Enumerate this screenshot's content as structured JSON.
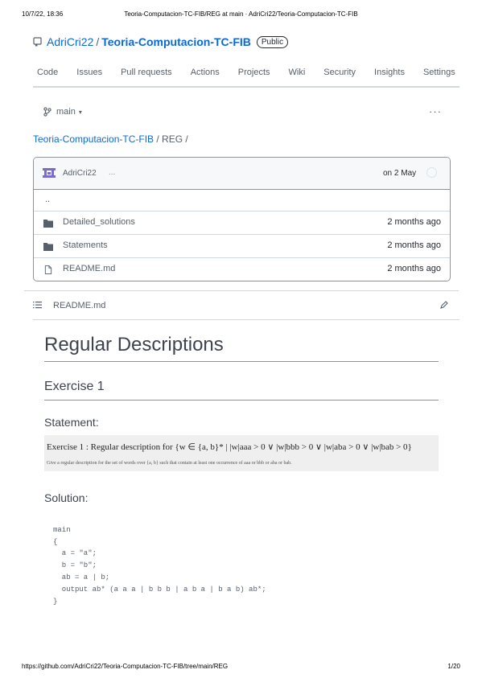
{
  "print": {
    "datetime": "10/7/22, 18:36",
    "page_title": "Teoria-Computacion-TC-FIB/REG at main · AdriCri22/Teoria-Computacion-TC-FIB",
    "url": "https://github.com/AdriCri22/Teoria-Computacion-TC-FIB/tree/main/REG",
    "page_number": "1/20"
  },
  "repo": {
    "owner": "AdriCri22",
    "separator": "/",
    "name": "Teoria-Computacion-TC-FIB",
    "visibility": "Public"
  },
  "tabs": [
    "Code",
    "Issues",
    "Pull requests",
    "Actions",
    "Projects",
    "Wiki",
    "Security",
    "Insights",
    "Settings"
  ],
  "branch": {
    "name": "main"
  },
  "breadcrumb": {
    "root": "Teoria-Computacion-TC-FIB",
    "rest": " / REG /"
  },
  "commit": {
    "author": "AdriCri22",
    "message": "...",
    "date": "on 2 May"
  },
  "files": {
    "parent": "..",
    "rows": [
      {
        "icon": "folder-icon",
        "name": "Detailed_solutions",
        "date": "2 months ago"
      },
      {
        "icon": "folder-icon",
        "name": "Statements",
        "date": "2 months ago"
      },
      {
        "icon": "file-icon",
        "name": "README.md",
        "date": "2 months ago"
      }
    ]
  },
  "readme": {
    "filename": "README.md",
    "h1": "Regular Descriptions",
    "h2": "Exercise 1",
    "statement_heading": "Statement:",
    "statement_line1": "Exercise 1 : Regular description for {w ∈ {a, b}* | |w|aaa > 0 ∨ |w|bbb > 0 ∨ |w|aba > 0 ∨ |w|bab > 0}",
    "statement_line2": "Give a regular description for the set of words over {a, b} such that contain at least one occurrence of aaa or bbb or aba or bab.",
    "solution_heading": "Solution:",
    "code_lines": [
      "main",
      "{",
      "  a = \"a\";",
      "  b = \"b\";",
      "  ab = a | b;",
      "  output ab* (a a a | b b b | a b a | b a b) ab*;",
      "}"
    ]
  },
  "colors": {
    "link": "#0969da",
    "muted": "#57606a",
    "border": "#d0d7de"
  }
}
